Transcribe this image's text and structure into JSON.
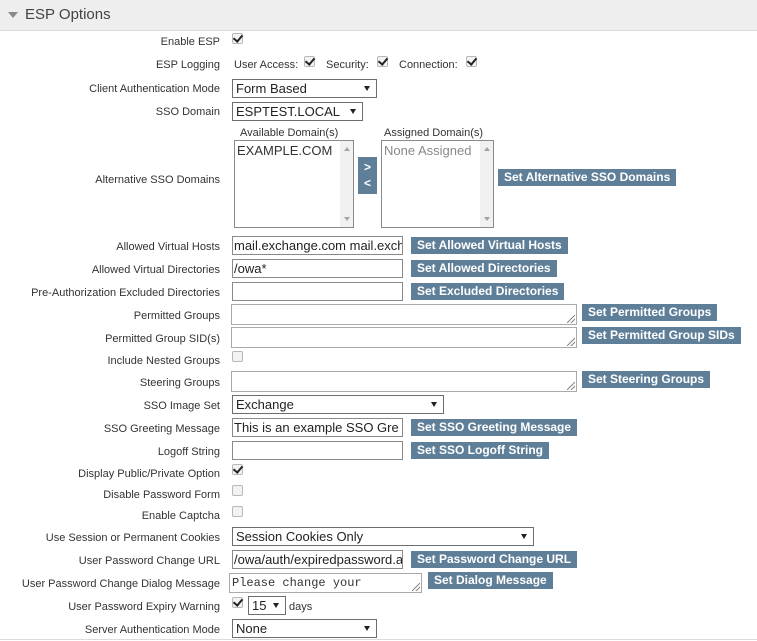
{
  "header": {
    "title": "ESP Options"
  },
  "labels": {
    "enable_esp": "Enable ESP",
    "esp_logging": "ESP Logging",
    "client_auth_mode": "Client Authentication Mode",
    "sso_domain": "SSO Domain",
    "alt_sso_domains": "Alternative SSO Domains",
    "allowed_virtual_hosts": "Allowed Virtual Hosts",
    "allowed_virtual_dirs": "Allowed Virtual Directories",
    "preauth_excluded_dirs": "Pre-Authorization Excluded Directories",
    "permitted_groups": "Permitted Groups",
    "permitted_group_sids": "Permitted Group SID(s)",
    "include_nested_groups": "Include Nested Groups",
    "steering_groups": "Steering Groups",
    "sso_image_set": "SSO Image Set",
    "sso_greeting_message": "SSO Greeting Message",
    "logoff_string": "Logoff String",
    "display_public_private": "Display Public/Private Option",
    "disable_password_form": "Disable Password Form",
    "enable_captcha": "Enable Captcha",
    "session_or_permanent_cookies": "Use Session or Permanent Cookies",
    "password_change_url": "User Password Change URL",
    "password_change_dialog": "User Password Change Dialog Message",
    "password_expiry_warning": "User Password Expiry Warning",
    "server_auth_mode": "Server Authentication Mode"
  },
  "logging": {
    "user_access": "User Access:",
    "security": "Security:",
    "connection": "Connection:"
  },
  "values": {
    "client_auth_mode": "Form Based",
    "sso_domain": "ESPTEST.LOCAL",
    "allowed_virtual_hosts": "mail.exchange.com mail.exch",
    "allowed_virtual_dirs": "/owa*",
    "preauth_excluded_dirs": "",
    "sso_image_set": "Exchange",
    "sso_greeting_message": "This is an example SSO Gre",
    "logoff_string": "",
    "cookies": "Session Cookies Only",
    "password_change_url": "/owa/auth/expiredpassword.a",
    "password_change_dialog": "Please change your",
    "expiry_days": "15",
    "days_unit": "days",
    "server_auth_mode": "None"
  },
  "domains": {
    "available_header": "Available Domain(s)",
    "assigned_header": "Assigned Domain(s)",
    "available": [
      "EXAMPLE.COM"
    ],
    "assigned_placeholder": "None Assigned",
    "move_right": ">",
    "move_left": "<"
  },
  "buttons": {
    "set_alt_sso_domains": "Set Alternative SSO Domains",
    "set_allowed_virtual_hosts": "Set Allowed Virtual Hosts",
    "set_allowed_dirs": "Set Allowed Directories",
    "set_excluded_dirs": "Set Excluded Directories",
    "set_permitted_groups": "Set Permitted Groups",
    "set_permitted_group_sids": "Set Permitted Group SIDs",
    "set_steering_groups": "Set Steering Groups",
    "set_sso_greeting": "Set SSO Greeting Message",
    "set_sso_logoff": "Set SSO Logoff String",
    "set_password_change_url": "Set Password Change URL",
    "set_dialog_message": "Set Dialog Message"
  },
  "checkboxes": {
    "enable_esp": true,
    "user_access": true,
    "security": true,
    "connection": true,
    "include_nested_groups": false,
    "display_public_private": true,
    "disable_password_form": false,
    "enable_captcha": false,
    "password_expiry_warning": true
  },
  "colors": {
    "button_bg": "#5f7f99",
    "header_bg": "#eeeeee"
  }
}
